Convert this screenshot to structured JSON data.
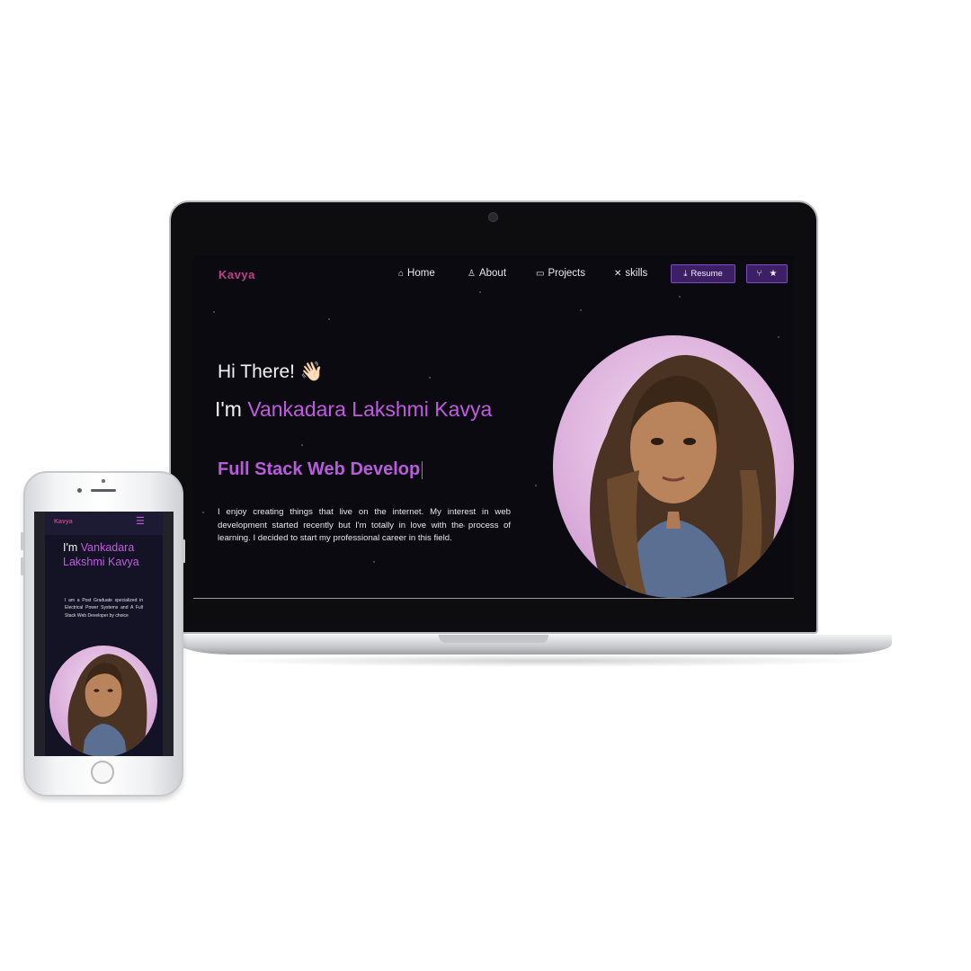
{
  "laptop": {
    "brand": "Kavya",
    "nav": [
      {
        "label": "Home",
        "icon": "home-icon"
      },
      {
        "label": "About",
        "icon": "user-icon"
      },
      {
        "label": "Projects",
        "icon": "monitor-icon"
      },
      {
        "label": "skills",
        "icon": "tools-icon"
      }
    ],
    "resume_label": "Resume",
    "greeting": "Hi There! 👋🏻",
    "intro_prefix": "I'm",
    "name": "Vankadara Lakshmi Kavya",
    "role_typing": "Full Stack Web Develop",
    "description": "I enjoy creating things that live on the internet. My interest in web development started recently but I'm totally in love with the process of learning. I decided to start my professional career in this field."
  },
  "phone": {
    "brand": "Kavya",
    "menu_icon": "☰",
    "intro_prefix": "I'm",
    "name": "Vankadara Lakshmi Kavya",
    "description": "I am a Post Graduate specialized in Electrical Power Systems and A Full Stack Web Developer by choice"
  },
  "colors": {
    "accent": "#c05be0",
    "brand": "#c2418d",
    "button_bg": "#3c1f64",
    "background": "#0b0a10"
  }
}
